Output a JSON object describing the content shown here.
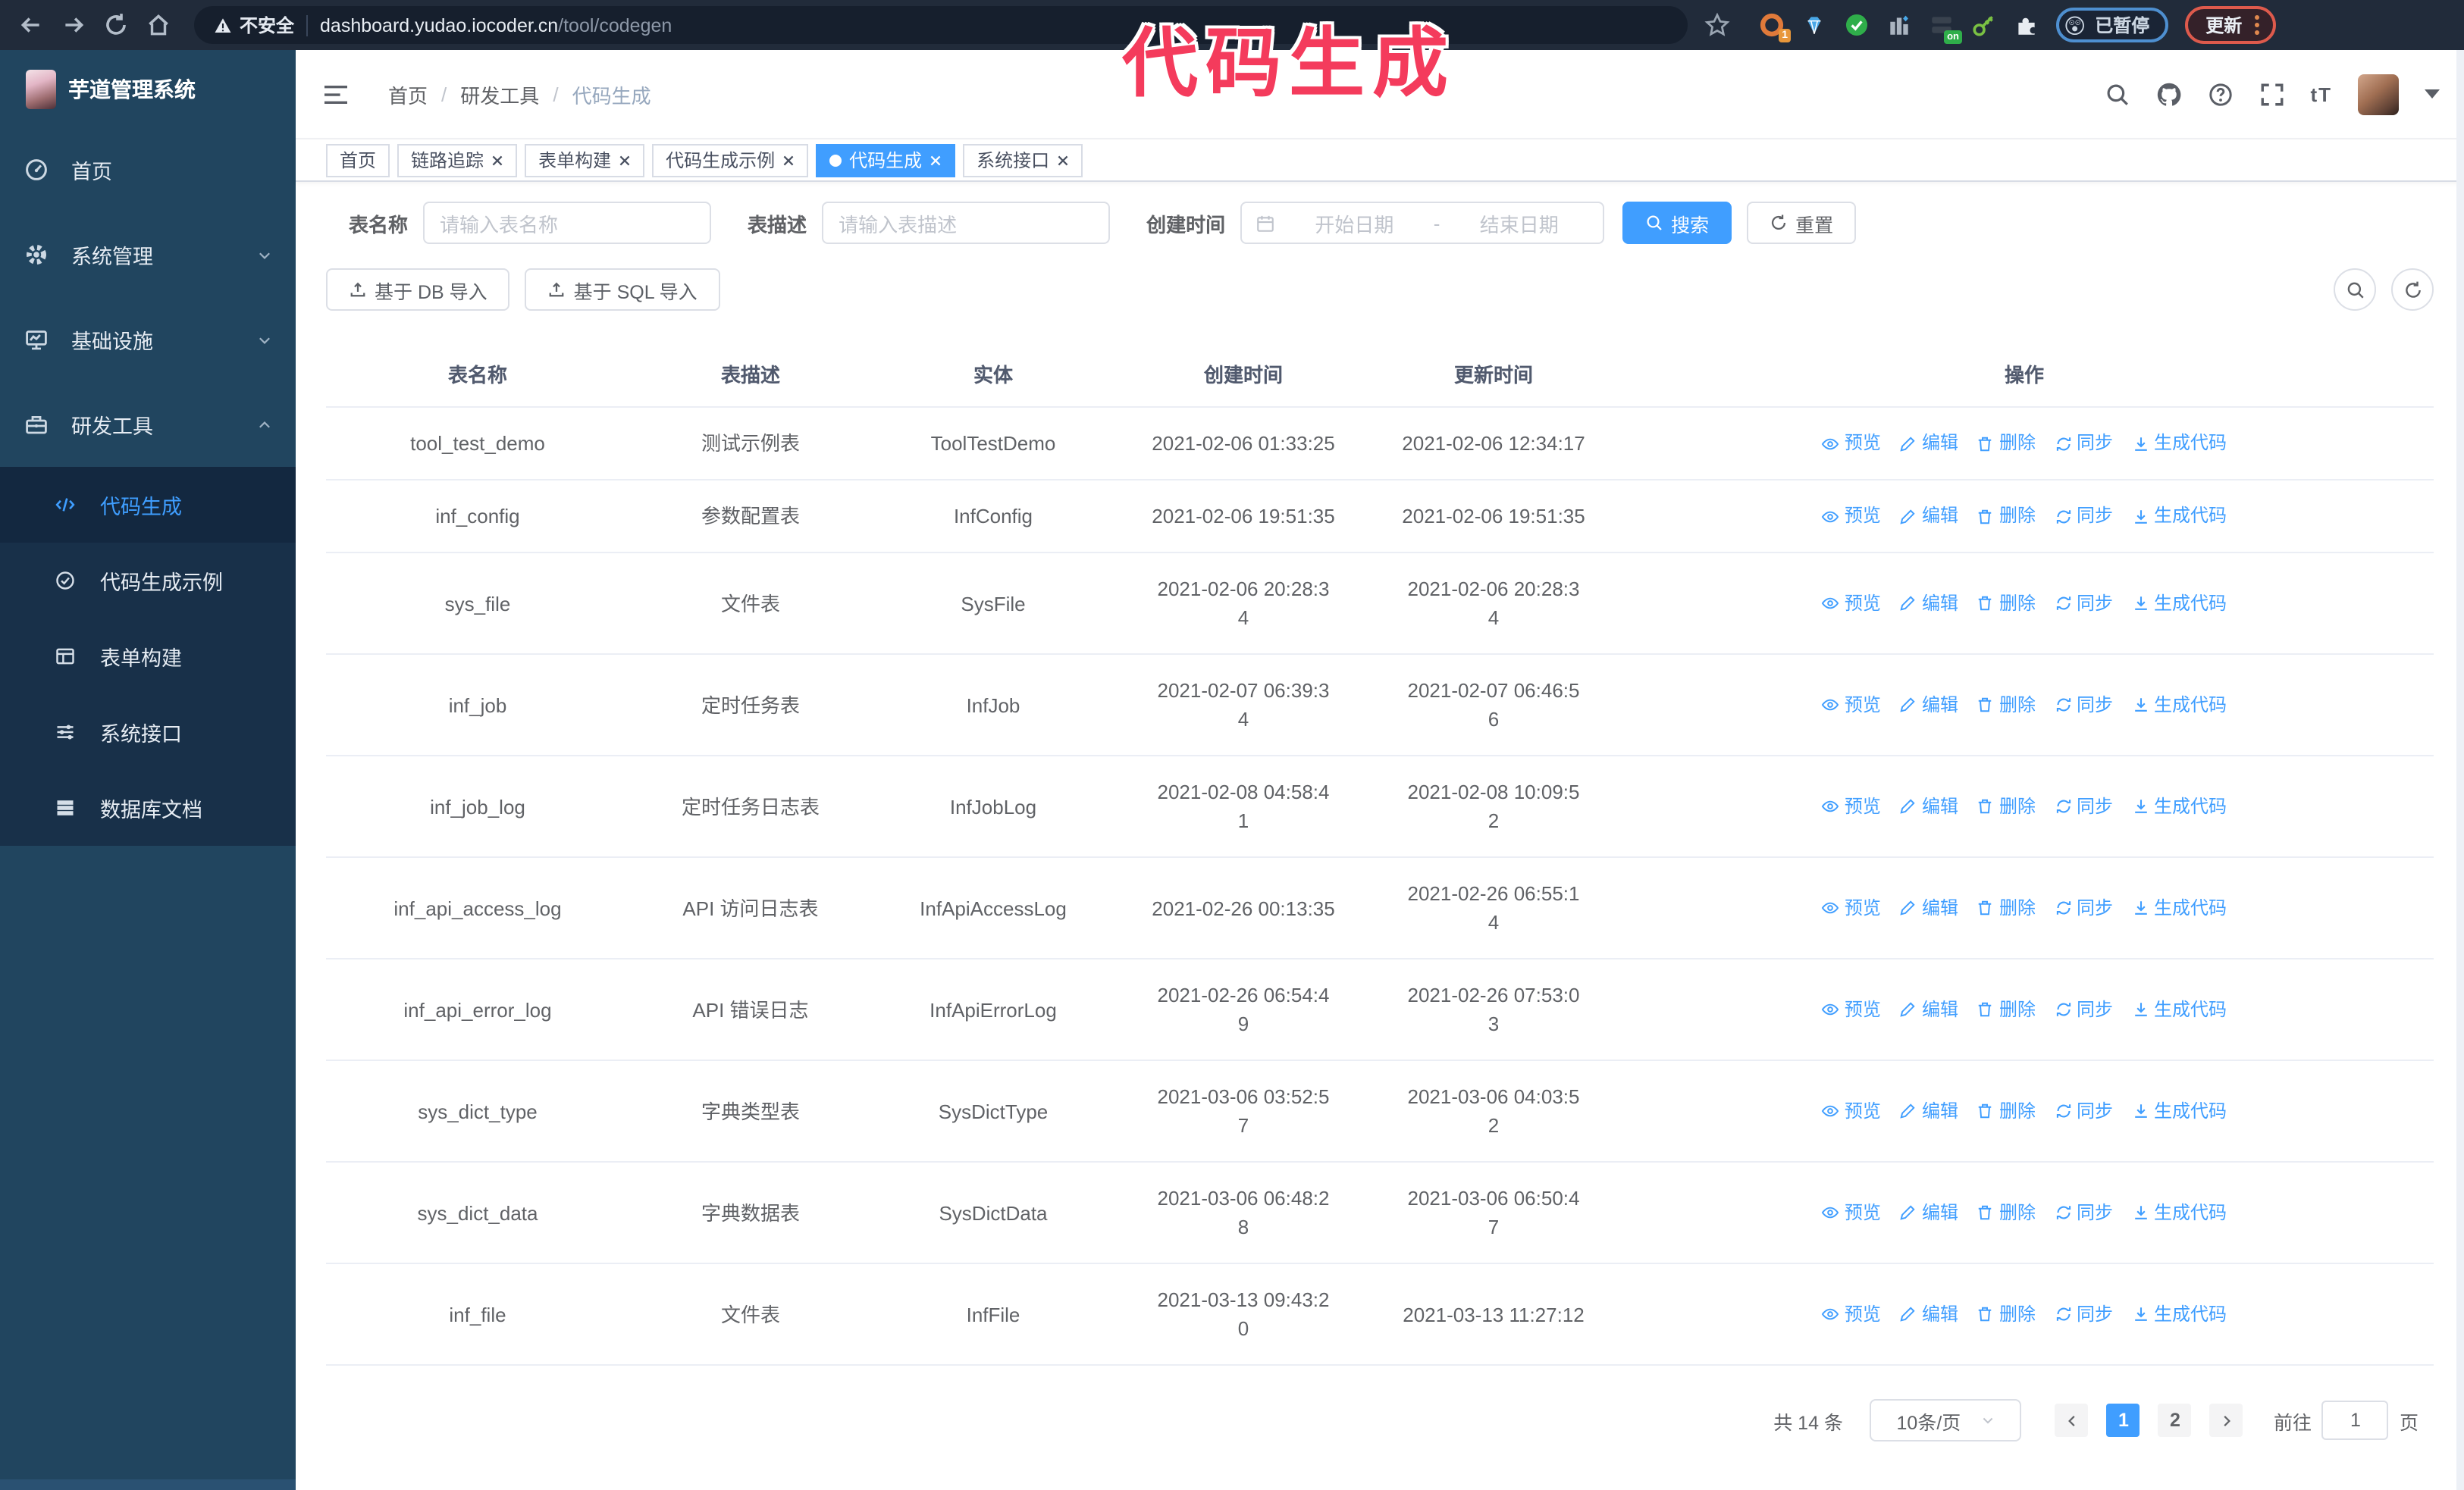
{
  "browser": {
    "security_label": "不安全",
    "url_host": "dashboard.yudao.iocoder.cn",
    "url_path": "/tool/codegen",
    "extension_badge": "1",
    "extension_on_badge": "on",
    "paused_emoji": "😲",
    "paused_label": "已暂停",
    "update_label": "更新"
  },
  "annotation": {
    "text": "代码生成",
    "color": "#f43b5c"
  },
  "sidebar": {
    "logo_title": "芋道管理系统",
    "items": [
      {
        "label": "首页"
      },
      {
        "label": "系统管理"
      },
      {
        "label": "基础设施"
      },
      {
        "label": "研发工具"
      }
    ],
    "submenu": [
      {
        "label": "代码生成",
        "active": true
      },
      {
        "label": "代码生成示例"
      },
      {
        "label": "表单构建"
      },
      {
        "label": "系统接口"
      },
      {
        "label": "数据库文档"
      }
    ]
  },
  "header": {
    "breadcrumb": [
      "首页",
      "研发工具",
      "代码生成"
    ],
    "breadcrumb_separator": "/",
    "font_icon_label": "tT"
  },
  "tabs": [
    {
      "label": "首页",
      "closable": false,
      "active": false
    },
    {
      "label": "链路追踪",
      "closable": true,
      "active": false
    },
    {
      "label": "表单构建",
      "closable": true,
      "active": false
    },
    {
      "label": "代码生成示例",
      "closable": true,
      "active": false
    },
    {
      "label": "代码生成",
      "closable": true,
      "active": true
    },
    {
      "label": "系统接口",
      "closable": true,
      "active": false
    }
  ],
  "search": {
    "name_label": "表名称",
    "name_placeholder": "请输入表名称",
    "desc_label": "表描述",
    "desc_placeholder": "请输入表描述",
    "time_label": "创建时间",
    "start_placeholder": "开始日期",
    "range_separator": "-",
    "end_placeholder": "结束日期",
    "search_button": "搜索",
    "reset_button": "重置"
  },
  "toolbar": {
    "import_db": "基于 DB 导入",
    "import_sql": "基于 SQL 导入"
  },
  "table": {
    "columns": [
      "表名称",
      "表描述",
      "实体",
      "创建时间",
      "更新时间",
      "操作"
    ],
    "ops": [
      "预览",
      "编辑",
      "删除",
      "同步",
      "生成代码"
    ],
    "rows": [
      {
        "name": "tool_test_demo",
        "desc": "测试示例表",
        "entity": "ToolTestDemo",
        "create": "2021-02-06 01:33:25",
        "update": "2021-02-06 12:34:17"
      },
      {
        "name": "inf_config",
        "desc": "参数配置表",
        "entity": "InfConfig",
        "create": "2021-02-06 19:51:35",
        "update": "2021-02-06 19:51:35"
      },
      {
        "name": "sys_file",
        "desc": "文件表",
        "entity": "SysFile",
        "create": "2021-02-06 20:28:3\n4",
        "update": "2021-02-06 20:28:3\n4"
      },
      {
        "name": "inf_job",
        "desc": "定时任务表",
        "entity": "InfJob",
        "create": "2021-02-07 06:39:3\n4",
        "update": "2021-02-07 06:46:5\n6"
      },
      {
        "name": "inf_job_log",
        "desc": "定时任务日志表",
        "entity": "InfJobLog",
        "create": "2021-02-08 04:58:4\n1",
        "update": "2021-02-08 10:09:5\n2"
      },
      {
        "name": "inf_api_access_log",
        "desc": "API 访问日志表",
        "entity": "InfApiAccessLog",
        "create": "2021-02-26 00:13:35",
        "update": "2021-02-26 06:55:1\n4"
      },
      {
        "name": "inf_api_error_log",
        "desc": "API 错误日志",
        "entity": "InfApiErrorLog",
        "create": "2021-02-26 06:54:4\n9",
        "update": "2021-02-26 07:53:0\n3"
      },
      {
        "name": "sys_dict_type",
        "desc": "字典类型表",
        "entity": "SysDictType",
        "create": "2021-03-06 03:52:5\n7",
        "update": "2021-03-06 04:03:5\n2"
      },
      {
        "name": "sys_dict_data",
        "desc": "字典数据表",
        "entity": "SysDictData",
        "create": "2021-03-06 06:48:2\n8",
        "update": "2021-03-06 06:50:4\n7"
      },
      {
        "name": "inf_file",
        "desc": "文件表",
        "entity": "InfFile",
        "create": "2021-03-13 09:43:2\n0",
        "update": "2021-03-13 11:27:12"
      }
    ]
  },
  "pagination": {
    "total_label": "共 14 条",
    "page_size": "10条/页",
    "pages": [
      "1",
      "2"
    ],
    "active_page": "1",
    "goto_label": "前往",
    "goto_value": "1",
    "page_unit": "页"
  }
}
